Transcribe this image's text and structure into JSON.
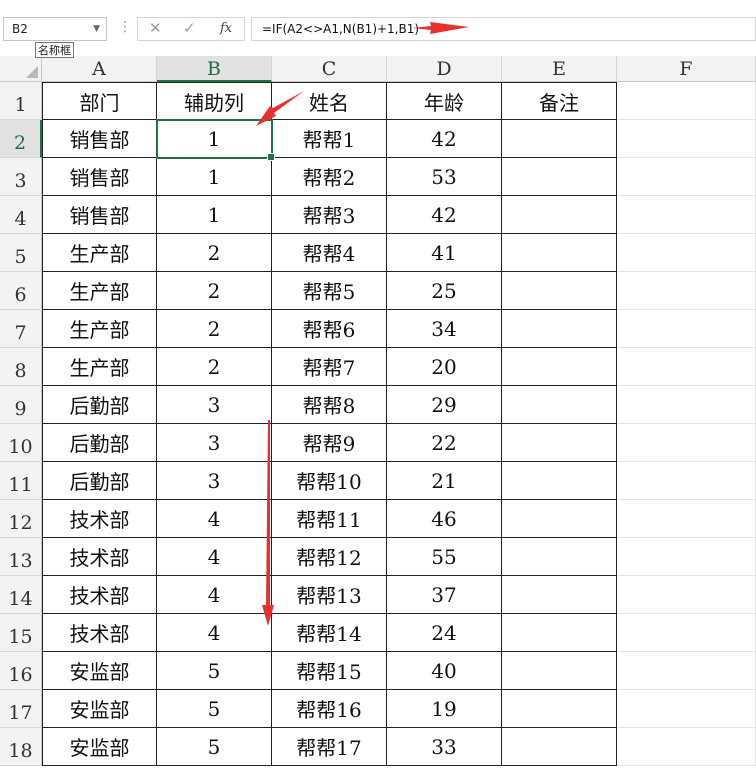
{
  "formula_bar": {
    "name_box": "B2",
    "name_box_tooltip": "名称框",
    "formula": "=IF(A2<>A1,N(B1)+1,B1)"
  },
  "sheet": {
    "columns": [
      "A",
      "B",
      "C",
      "D",
      "E",
      "F"
    ],
    "rows": [
      "1",
      "2",
      "3",
      "4",
      "5",
      "6",
      "7",
      "8",
      "9",
      "10",
      "11",
      "12",
      "13",
      "14",
      "15",
      "16",
      "17",
      "18"
    ],
    "active_cell": {
      "col": "B",
      "row": "2"
    },
    "header": [
      "部门",
      "辅助列",
      "姓名",
      "年龄",
      "备注"
    ],
    "data": [
      [
        "销售部",
        "1",
        "帮帮1",
        "42",
        ""
      ],
      [
        "销售部",
        "1",
        "帮帮2",
        "53",
        ""
      ],
      [
        "销售部",
        "1",
        "帮帮3",
        "42",
        ""
      ],
      [
        "生产部",
        "2",
        "帮帮4",
        "41",
        ""
      ],
      [
        "生产部",
        "2",
        "帮帮5",
        "25",
        ""
      ],
      [
        "生产部",
        "2",
        "帮帮6",
        "34",
        ""
      ],
      [
        "生产部",
        "2",
        "帮帮7",
        "20",
        ""
      ],
      [
        "后勤部",
        "3",
        "帮帮8",
        "29",
        ""
      ],
      [
        "后勤部",
        "3",
        "帮帮9",
        "22",
        ""
      ],
      [
        "后勤部",
        "3",
        "帮帮10",
        "21",
        ""
      ],
      [
        "技术部",
        "4",
        "帮帮11",
        "46",
        ""
      ],
      [
        "技术部",
        "4",
        "帮帮12",
        "55",
        ""
      ],
      [
        "技术部",
        "4",
        "帮帮13",
        "37",
        ""
      ],
      [
        "技术部",
        "4",
        "帮帮14",
        "24",
        ""
      ],
      [
        "安监部",
        "5",
        "帮帮15",
        "40",
        ""
      ],
      [
        "安监部",
        "5",
        "帮帮16",
        "19",
        ""
      ],
      [
        "安监部",
        "5",
        "帮帮17",
        "33",
        ""
      ]
    ]
  },
  "colors": {
    "accent_green": "#217346",
    "annotation_arrow": "#e8302c"
  },
  "icons": {
    "cancel": "close-icon",
    "confirm": "check-icon",
    "function": "fx-icon",
    "more": "more-dots-icon"
  }
}
